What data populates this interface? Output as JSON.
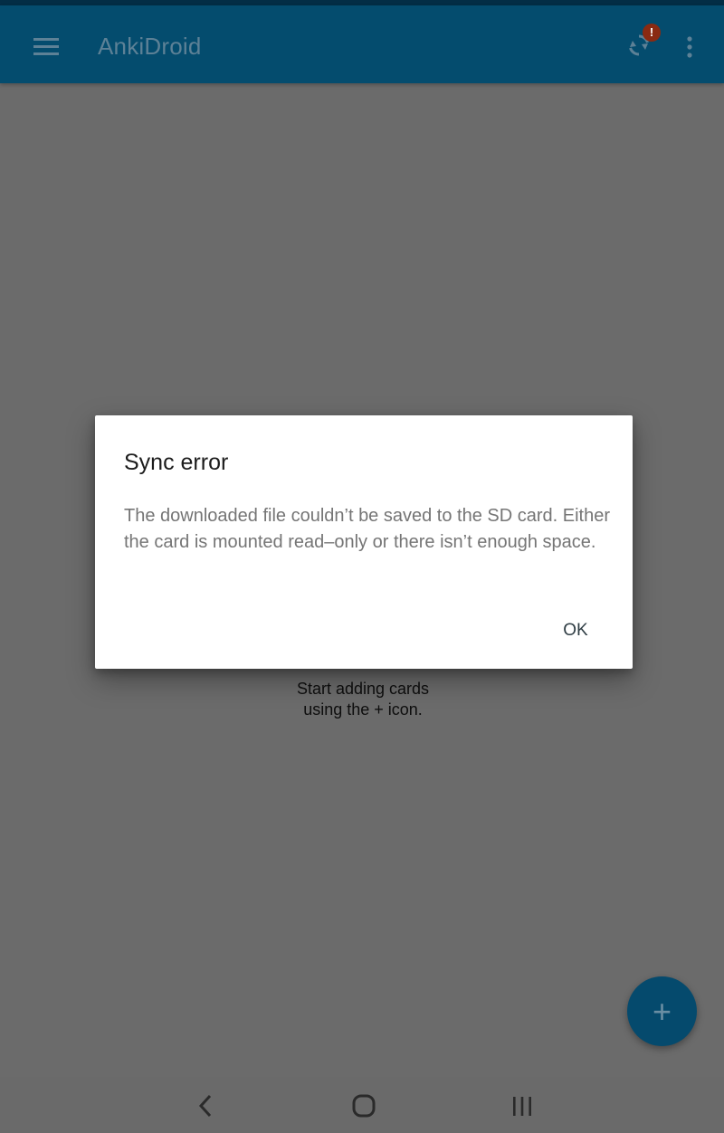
{
  "app": {
    "title": "AnkiDroid",
    "colors": {
      "toolbar": "#044c6e",
      "status_strip": "#032d45",
      "scrim_background": "#6b6b6b",
      "fab": "#054a6d",
      "badge": "#8a2a12"
    }
  },
  "toolbar": {
    "menu_icon": "hamburger-menu-icon",
    "sync_icon": "sync-icon",
    "sync_badge": "!",
    "overflow_icon": "more-vertical-icon"
  },
  "empty_state": {
    "line1": "Start adding cards",
    "line2": "using the + icon."
  },
  "fab": {
    "label": "+",
    "icon": "add-icon"
  },
  "dialog": {
    "title": "Sync error",
    "message": "The downloaded file couldn’t be saved to the SD card. Either the card is mounted read–only or there isn’t enough space.",
    "ok_label": "OK"
  },
  "navbar": {
    "back_icon": "back-chevron-icon",
    "home_icon": "home-icon",
    "recents_icon": "recents-icon"
  }
}
